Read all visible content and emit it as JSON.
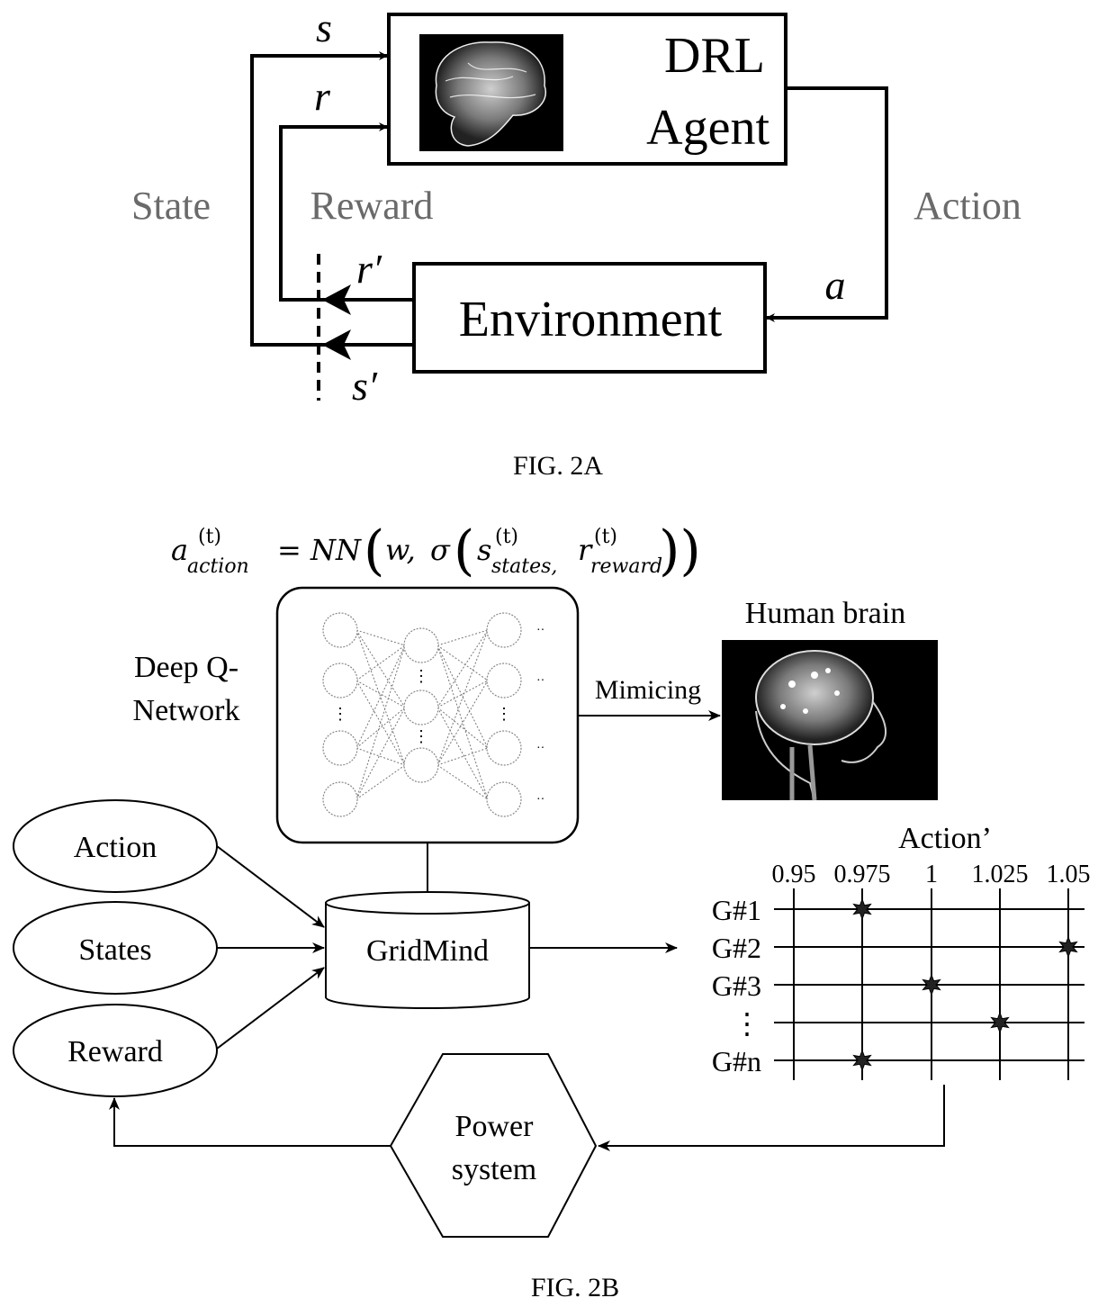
{
  "fig2a": {
    "caption": "FIG. 2A",
    "agent_box": {
      "line1": "DRL",
      "line2": "Agent",
      "image_icon": "brain-image"
    },
    "environment_box": {
      "label": "Environment"
    },
    "flow_labels": {
      "state": "State",
      "reward": "Reward",
      "action": "Action"
    },
    "signal_symbols": {
      "s": "s",
      "r": "r",
      "r_prime": "r′",
      "s_prime": "s′",
      "a": "a"
    }
  },
  "fig2b": {
    "caption": "FIG. 2B",
    "formula": {
      "lhs_base": "a",
      "lhs_sup": "(t)",
      "lhs_sub": "action",
      "eq": "= NN",
      "w": "w,",
      "sigma": "σ",
      "s_base": "s",
      "s_sup": "(t)",
      "s_sub": "states,",
      "r_base": "r",
      "r_sup": "(t)",
      "r_sub": "reward"
    },
    "dqn_label_line1": "Deep Q-",
    "dqn_label_line2": "Network",
    "mimic_label": "Mimicing",
    "human_brain_label": "Human brain",
    "inputs": [
      "Action",
      "States",
      "Reward"
    ],
    "gridmind_label": "GridMind",
    "power_system_line1": "Power",
    "power_system_line2": "system",
    "action_grid": {
      "title": "Action’",
      "columns": [
        "0.95",
        "0.975",
        "1",
        "1.025",
        "1.05"
      ],
      "rows": [
        "G#1",
        "G#2",
        "G#3",
        "⋮",
        "G#n"
      ],
      "selected": [
        {
          "row": 0,
          "value": "0.975"
        },
        {
          "row": 1,
          "value": "1.05"
        },
        {
          "row": 2,
          "value": "1"
        },
        {
          "row": 3,
          "value": "1.025"
        },
        {
          "row": 4,
          "value": "0.975"
        }
      ]
    }
  }
}
